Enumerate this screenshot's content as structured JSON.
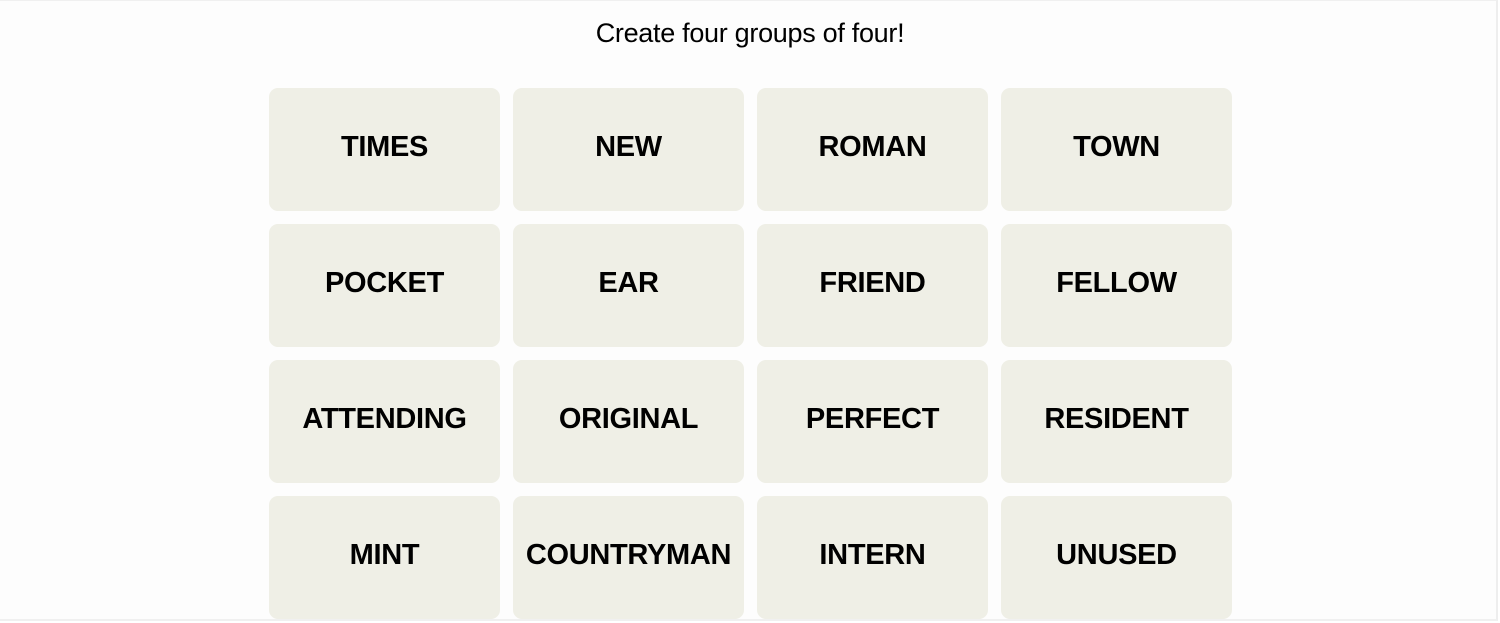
{
  "header": {
    "subtitle": "Create four groups of four!"
  },
  "board": {
    "tiles": [
      "TIMES",
      "NEW",
      "ROMAN",
      "TOWN",
      "POCKET",
      "EAR",
      "FRIEND",
      "FELLOW",
      "ATTENDING",
      "ORIGINAL",
      "PERFECT",
      "RESIDENT",
      "MINT",
      "COUNTRYMAN",
      "INTERN",
      "UNUSED"
    ]
  },
  "colors": {
    "tile_background": "#efefe6",
    "tile_text": "#000000",
    "page_background": "#ffffff"
  }
}
